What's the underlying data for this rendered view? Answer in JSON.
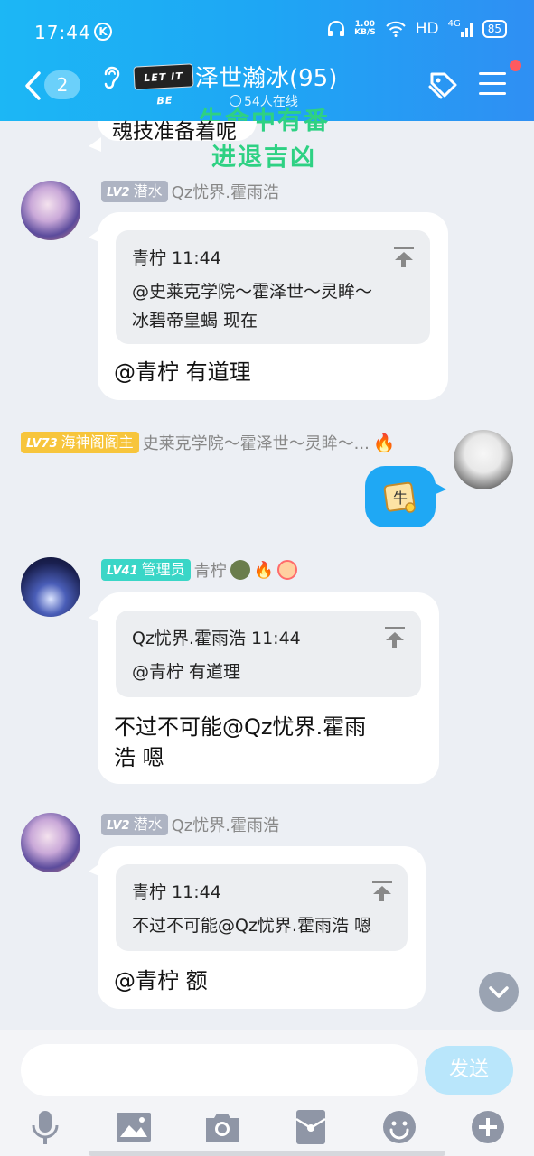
{
  "status_bar": {
    "time": "17:44",
    "k_badge": "K",
    "speed_top": "1.00",
    "speed_unit": "KB/S",
    "network": "HD",
    "signal": "4G",
    "battery": "85"
  },
  "header": {
    "unread_count": "2",
    "logo_text": "LET IT BE",
    "title": "泽世瀚冰(95)",
    "online": "54人在线",
    "accent": "#1ea6f4"
  },
  "overlay": {
    "line1": "生命中有番",
    "line2": "进退吉凶"
  },
  "messages": [
    {
      "level": "LV2",
      "title": "潜水",
      "nickname": "Qz忧界.霍雨浩",
      "quote_author": "青柠 11:44",
      "quote_lines": [
        "@史莱克学院～霍泽世～灵眸～",
        "冰碧帝皇蝎 现在"
      ],
      "text_lines": [
        "@青柠 有道理"
      ]
    },
    {
      "level": "LV73",
      "title": "海神阁阁主",
      "nickname": "史莱克学院～霍泽世～灵眸～...",
      "sticker": "牛"
    },
    {
      "level": "LV41",
      "title": "管理员",
      "nickname": "青柠",
      "quote_author": "Qz忧界.霍雨浩 11:44",
      "quote_lines": [
        "@青柠 有道理"
      ],
      "text_lines": [
        "不过不可能@Qz忧界.霍雨",
        "浩 嗯"
      ]
    },
    {
      "level": "LV2",
      "title": "潜水",
      "nickname": "Qz忧界.霍雨浩",
      "quote_author": "青柠 11:44",
      "quote_lines": [
        "不过不可能@Qz忧界.霍雨浩 嗯"
      ],
      "text_lines": [
        "@青柠 额"
      ]
    }
  ],
  "top_partial_text": "魂技准备着呢",
  "input": {
    "placeholder": "",
    "send_label": "发送"
  },
  "toolbar_icons": [
    "microphone-icon",
    "image-icon",
    "camera-icon",
    "red-packet-icon",
    "emoji-icon",
    "plus-icon"
  ]
}
